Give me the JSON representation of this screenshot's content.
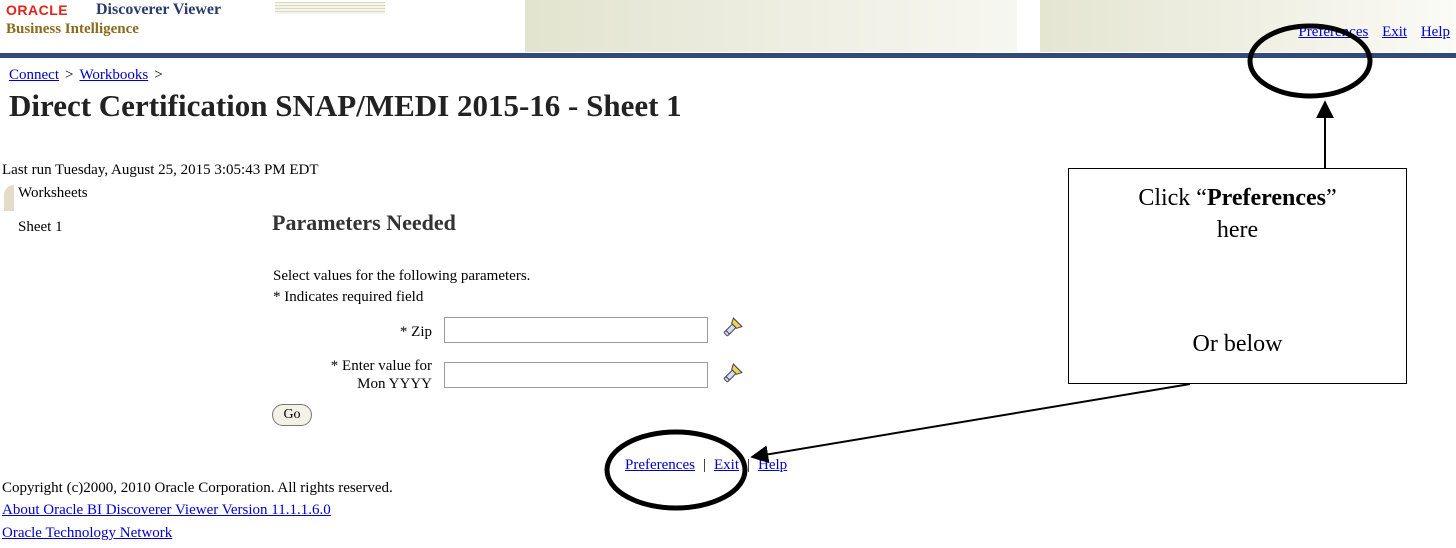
{
  "header": {
    "oracle_wordmark": "ORACLE",
    "product_name": "Discoverer Viewer",
    "suite_name": "Business Intelligence",
    "links": {
      "preferences": "Preferences",
      "exit": "Exit",
      "help": "Help"
    }
  },
  "breadcrumb": {
    "connect": "Connect",
    "workbooks": "Workbooks",
    "separator": ">"
  },
  "page_title": "Direct Certification SNAP/MEDI 2015-16 - Sheet 1",
  "last_run": "Last run Tuesday, August 25, 2015 3:05:43 PM EDT",
  "sidebar": {
    "heading": "Worksheets",
    "items": [
      {
        "label": "Sheet 1"
      }
    ]
  },
  "parameters": {
    "heading": "Parameters Needed",
    "instructions": "Select values for the following parameters.",
    "required_note": "* Indicates required field",
    "fields": [
      {
        "label": "* Zip",
        "value": ""
      },
      {
        "label_line1": "* Enter value for",
        "label_line2": "Mon YYYY",
        "value": ""
      }
    ],
    "go_label": "Go"
  },
  "footer": {
    "links": {
      "preferences": "Preferences",
      "exit": "Exit",
      "help": "Help",
      "separator": "|"
    },
    "copyright": "Copyright (c)2000, 2010 Oracle Corporation. All rights reserved.",
    "about_link": "About Oracle BI Discoverer Viewer Version 11.1.1.6.0",
    "otn_link": "Oracle Technology Network"
  },
  "annotation": {
    "line1_prefix": "Click “",
    "line1_bold": "Preferences",
    "line1_suffix": "”",
    "line2": "here",
    "line3": "Or below"
  },
  "icons": {
    "lov": "flashlight-search-icon",
    "annotation_arrow": "arrow-icon",
    "highlight": "circle-highlight"
  },
  "colors": {
    "oracle_red": "#e2231a",
    "header_rule": "#34497a",
    "link": "#0000cc"
  }
}
